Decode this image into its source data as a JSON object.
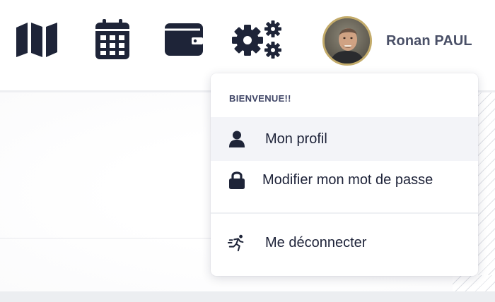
{
  "header": {
    "icons": [
      {
        "name": "map-icon"
      },
      {
        "name": "calendar-icon"
      },
      {
        "name": "wallet-icon"
      },
      {
        "name": "gears-icon"
      }
    ],
    "user": {
      "name": "Ronan PAUL",
      "avatar_border_color": "#c3ab6a"
    }
  },
  "dropdown": {
    "header": "BIENVENUE!!",
    "items": [
      {
        "label": "Mon profil",
        "icon": "user-icon",
        "active": true
      },
      {
        "label": "Modifier mon mot de passe",
        "icon": "lock-icon",
        "active": false
      },
      {
        "label": "Me déconnecter",
        "icon": "running-person-icon",
        "active": false
      }
    ]
  },
  "colors": {
    "icon_dark": "#1e2438",
    "user_name": "#4a5067",
    "menu_text": "#1d2238",
    "active_row": "#f3f4f8"
  }
}
